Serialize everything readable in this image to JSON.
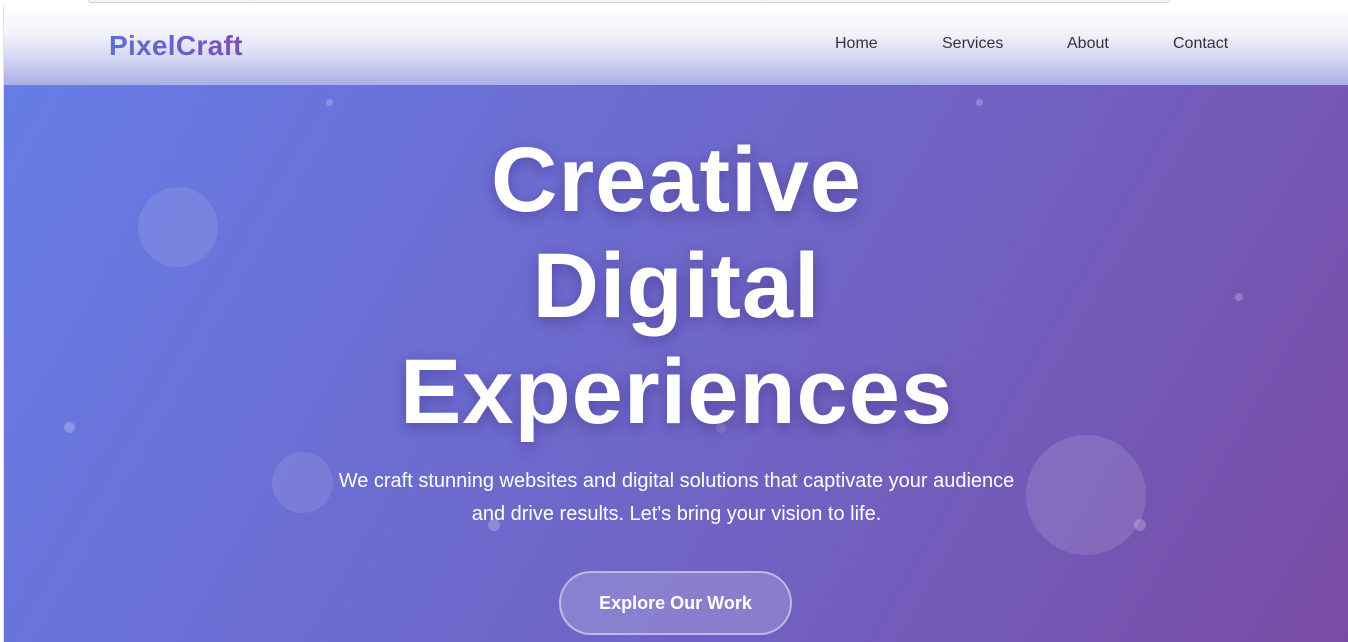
{
  "brand": {
    "name": "PixelCraft"
  },
  "nav": {
    "home": "Home",
    "services": "Services",
    "about": "About",
    "contact": "Contact"
  },
  "hero": {
    "headline_line1": "Creative",
    "headline_line2": "Digital",
    "headline_line3": "Experiences",
    "subtitle_line1": "We craft stunning websites and digital solutions that captivate your audience",
    "subtitle_line2": "and drive results. Let's bring your vision to life.",
    "cta_label": "Explore Our Work"
  },
  "colors": {
    "gradient_start": "#667de6",
    "gradient_end": "#7a4ba5",
    "logo": "#5b60c8",
    "nav_text": "#333340"
  }
}
